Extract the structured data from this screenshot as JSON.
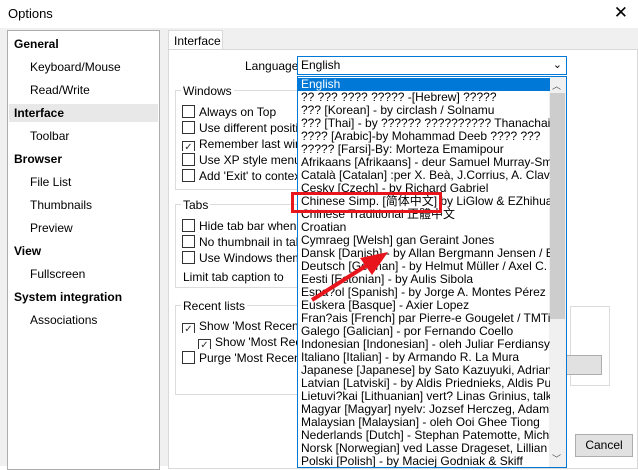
{
  "window": {
    "title": "Options",
    "close": "✕"
  },
  "sidebar": {
    "items": [
      {
        "label": "General",
        "level": 0
      },
      {
        "label": "Keyboard/Mouse",
        "level": 1
      },
      {
        "label": "Read/Write",
        "level": 1
      },
      {
        "label": "Interface",
        "level": 0,
        "selected": true
      },
      {
        "label": "Toolbar",
        "level": 1
      },
      {
        "label": "Browser",
        "level": 0
      },
      {
        "label": "File List",
        "level": 1
      },
      {
        "label": "Thumbnails",
        "level": 1
      },
      {
        "label": "Preview",
        "level": 1
      },
      {
        "label": "View",
        "level": 0
      },
      {
        "label": "Fullscreen",
        "level": 1
      },
      {
        "label": "System integration",
        "level": 0
      },
      {
        "label": "Associations",
        "level": 1
      }
    ]
  },
  "tab": "Interface",
  "language": {
    "label": "Language",
    "value": "English",
    "options": [
      "English",
      "?? ??? ???? ?????  -[Hebrew] ?????",
      "??? [Korean] - by circlash / Solnamu",
      "??? [Thai] - by ?????? ?????????? Thanachai Wa",
      "???? [Arabic]-by Mohammad Deeb ???? ???",
      "????? [Farsi]-By: Morteza Emamipour",
      "Afrikaans [Afrikaans] - deur Samuel Murray-Smit",
      "Català [Catalan] :per X. Beà, J.Corrius, A. Clavell",
      "Cesky [Czech] - by Richard Gabriel",
      "Chinese Simp. [简体中文] by LiGlow & EZhihuaStudio",
      "Chinese Traditional 正體中文",
      "Croatian",
      "Cymraeg [Welsh] gan Geraint Jones",
      "Dansk [Danish] - by Allan Bergmann Jensen / Bjarne",
      "Deutsch [German] - by Helmut Müller / Axel C. Burgbacher",
      "Eesti [Estonian] - by Aulis Sibola",
      "Espa?ol [Spanish] - by Jorge A. Montes Pérez",
      "Euskera [Basque] - Axier Lopez",
      "Fran?ais [French] par Pierre-e Gougelet / TMTisFree",
      "Galego [Galician] - por Fernando Coello",
      "Indonesian [Indonesian] - oleh Juliar Ferdiansyah",
      "Italiano [Italian] - by Armando R. La Mura",
      "Japanese [Japanese] by Sato Kazuyuki, Adrian Ivana",
      "Latvian [Latviski] - by Aldis Priednieks, Aldis Putelis",
      "Lietuvi?kai [Lithuanian] vert? Linas Grinius, talkininkai",
      "Magyar [Magyar] nyelv: Jozsef Herczeg, Adam Mako",
      "Malaysian [Malaysian] - oleh Ooi Ghee Tiong",
      "Nederlands [Dutch] - Stephan Patemotte, Michiel Oo",
      "Norsk [Norwegian] ved Lasse Drageset, Lillian Solum",
      "Polski [Polish] - by Maciej Godniak & Skiff"
    ]
  },
  "windows": {
    "title": "Windows",
    "options": [
      {
        "label": "Always on Top",
        "checked": false
      },
      {
        "label": "Use different position",
        "checked": false
      },
      {
        "label": "Remember last window",
        "checked": true
      },
      {
        "label": "Use XP style menus",
        "checked": false
      },
      {
        "label": "Add 'Exit' to context menu",
        "checked": false
      }
    ]
  },
  "tabs": {
    "title": "Tabs",
    "options": [
      {
        "label": "Hide tab bar when only",
        "checked": false
      },
      {
        "label": "No thumbnail in tab",
        "checked": false
      },
      {
        "label": "Use Windows theme",
        "checked": false
      }
    ],
    "limit_label": "Limit tab caption to"
  },
  "recent": {
    "title": "Recent lists",
    "options": [
      {
        "label": "Show 'Most Recently",
        "checked": true,
        "indent": false
      },
      {
        "label": "Show 'Most Recently",
        "checked": true,
        "indent": true
      },
      {
        "label": "Purge 'Most Recently",
        "checked": false,
        "indent": false
      }
    ]
  },
  "buttons": {
    "cancel": "Cancel"
  },
  "annotation_color": "#e8161c",
  "accent": "#0078d7"
}
